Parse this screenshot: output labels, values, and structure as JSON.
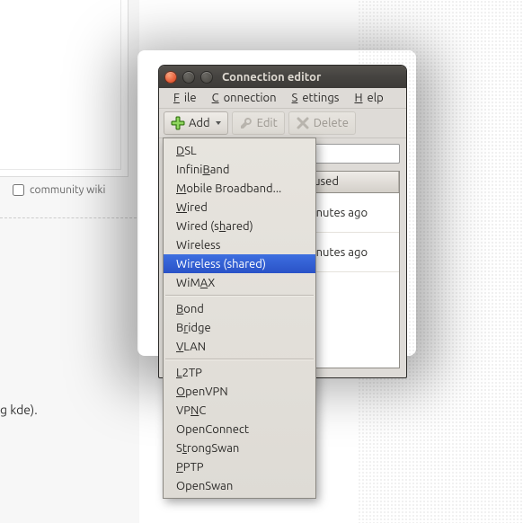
{
  "page_fragments": {
    "community_wiki_label": "community wiki",
    "kde_text": "g kde)."
  },
  "window": {
    "title": "Connection editor",
    "menubar": {
      "file": {
        "label": "File",
        "hotkey_index": 0
      },
      "connection": {
        "label": "Connection",
        "hotkey_index": 0
      },
      "settings": {
        "label": "Settings",
        "hotkey_index": 0
      },
      "help": {
        "label": "Help",
        "hotkey_index": 0
      }
    },
    "toolbar": {
      "add_label": "Add",
      "edit_label": "Edit",
      "delete_label": "Delete"
    },
    "search": {
      "value": "",
      "placeholder": ""
    },
    "table": {
      "headers": {
        "col1": "",
        "col2": "t used"
      },
      "rows": [
        {
          "name": "",
          "last_used": "ninutes ago"
        },
        {
          "name": "",
          "last_used": "ninutes ago"
        }
      ]
    }
  },
  "dropdown": {
    "groups": [
      [
        {
          "label": "DSL",
          "hotkey_index": 0
        },
        {
          "label": "InfiniBand",
          "hotkey_index": 6
        },
        {
          "label": "Mobile Broadband...",
          "hotkey_index": 0
        },
        {
          "label": "Wired",
          "hotkey_index": 0
        },
        {
          "label": "Wired (shared)",
          "hotkey_index": 8
        },
        {
          "label": "Wireless",
          "hotkey_index": -1
        },
        {
          "label": "Wireless (shared)",
          "hotkey_index": -1,
          "highlight": true
        },
        {
          "label": "WiMAX",
          "hotkey_index": 3
        }
      ],
      [
        {
          "label": "Bond",
          "hotkey_index": 0
        },
        {
          "label": "Bridge",
          "hotkey_index": 1
        },
        {
          "label": "VLAN",
          "hotkey_index": 0
        }
      ],
      [
        {
          "label": "L2TP",
          "hotkey_index": 0
        },
        {
          "label": "OpenVPN",
          "hotkey_index": 0
        },
        {
          "label": "VPNC",
          "hotkey_index": 2
        },
        {
          "label": "OpenConnect",
          "hotkey_index": -1
        },
        {
          "label": "StrongSwan",
          "hotkey_index": 1
        },
        {
          "label": "PPTP",
          "hotkey_index": 0
        },
        {
          "label": "OpenSwan",
          "hotkey_index": -1
        }
      ]
    ]
  }
}
